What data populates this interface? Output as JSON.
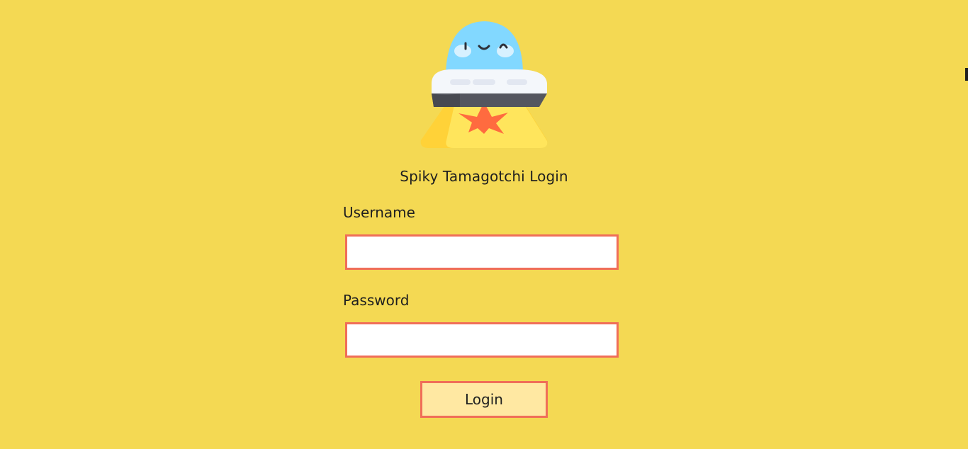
{
  "logo": {
    "icon": "ufo-mascot-icon",
    "colors": {
      "dome": "#82d8ff",
      "saucer": "#f4f7fb",
      "base": "#54565f",
      "flame": "#ff6b3f",
      "beam": "#ffe55c"
    }
  },
  "form": {
    "title": "Spiky Tamagotchi Login",
    "username_label": "Username",
    "password_label": "Password",
    "username_value": "",
    "password_value": "",
    "submit_label": "Login"
  },
  "theme": {
    "background": "#f4d953",
    "border": "#f06e58",
    "button_background": "#ffe8a2"
  }
}
